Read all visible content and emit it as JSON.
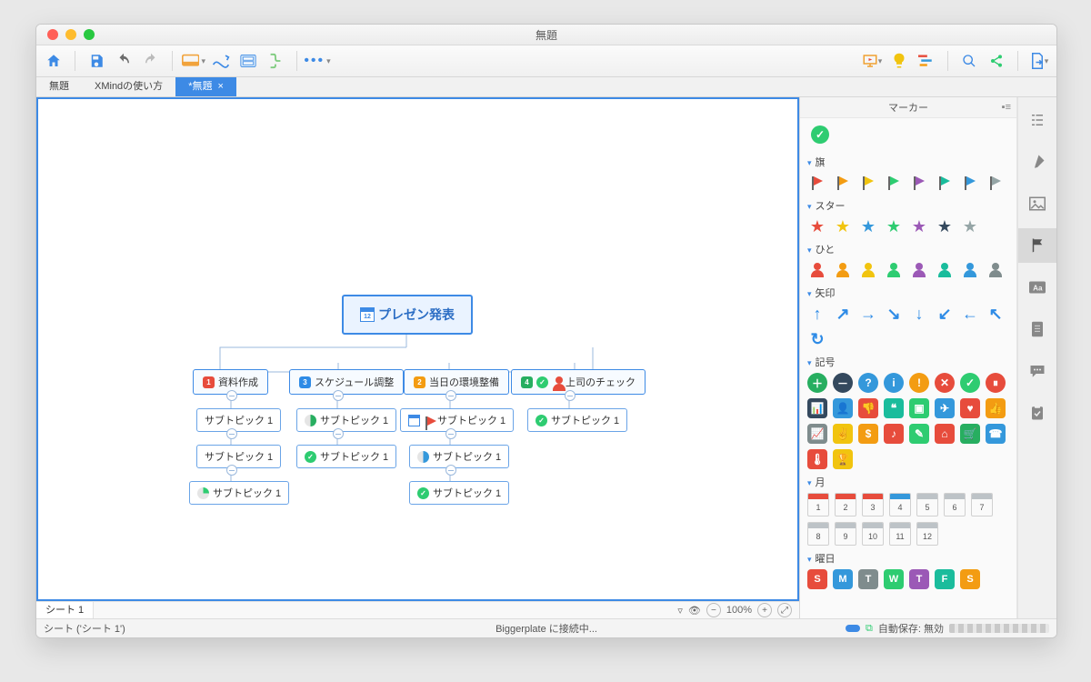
{
  "window": {
    "title": "無題"
  },
  "toolbar": {
    "items": [
      "home",
      "save",
      "undo",
      "redo",
      "style",
      "layout",
      "export",
      "outline",
      "more"
    ],
    "right_items": [
      "presentation",
      "idea",
      "gantt",
      "search",
      "share",
      "send"
    ]
  },
  "tabs": [
    {
      "label": "無題",
      "active": false
    },
    {
      "label": "XMindの使い方",
      "active": false
    },
    {
      "label": "*無題",
      "active": true,
      "closable": true
    }
  ],
  "mindmap": {
    "root": {
      "label": "プレゼン発表"
    },
    "branches": [
      {
        "badge": {
          "num": "1",
          "color": "#e74c3c"
        },
        "label": "資料作成",
        "subs": [
          {
            "label": "サブトピック 1"
          },
          {
            "label": "サブトピック 1"
          },
          {
            "label": "サブトピック 1",
            "icon": "pie-quarter"
          }
        ]
      },
      {
        "badge": {
          "num": "3",
          "color": "#2e8be6"
        },
        "label": "スケジュール調整",
        "subs": [
          {
            "label": "サブトピック 1",
            "icon": "pie-half"
          },
          {
            "label": "サブトピック 1",
            "icon": "check-green"
          }
        ]
      },
      {
        "badge": {
          "num": "2",
          "color": "#f39c12"
        },
        "label": "当日の環境整備",
        "subs": [
          {
            "label": "サブトピック 1",
            "icons": [
              "cal",
              "flag-red"
            ]
          },
          {
            "label": "サブトピック 1",
            "icon": "pie-half-blue"
          },
          {
            "label": "サブトピック 1",
            "icon": "check-green"
          }
        ]
      },
      {
        "badge": {
          "num": "4",
          "color": "#27ae60"
        },
        "extra_icons": [
          "check-green",
          "user-red"
        ],
        "label": "上司のチェック",
        "subs": [
          {
            "label": "サブトピック 1",
            "icon": "check-green"
          }
        ]
      }
    ]
  },
  "sheet": {
    "tab": "シート 1",
    "zoom": "100%"
  },
  "marker_panel": {
    "title": "マーカー",
    "sections": {
      "flag": {
        "title": "旗",
        "colors": [
          "#e74c3c",
          "#f39c12",
          "#f1c40f",
          "#2ecc71",
          "#9b59b6",
          "#1abc9c",
          "#3498db",
          "#95a5a6"
        ]
      },
      "star": {
        "title": "スター",
        "colors": [
          "#e74c3c",
          "#f1c40f",
          "#3498db",
          "#2ecc71",
          "#9b59b6",
          "#34495e",
          "#95a5a6"
        ]
      },
      "people": {
        "title": "ひと",
        "colors": [
          "#e74c3c",
          "#f39c12",
          "#f1c40f",
          "#2ecc71",
          "#9b59b6",
          "#1abc9c",
          "#3498db",
          "#7f8c8d"
        ]
      },
      "arrow": {
        "title": "矢印",
        "glyphs": [
          "↑",
          "↗",
          "→",
          "↘",
          "↓",
          "↙",
          "←",
          "↖",
          "↻"
        ],
        "color": "#2e8be6"
      },
      "symbol": {
        "title": "記号",
        "items": [
          {
            "bg": "#27ae60",
            "t": "＋",
            "r": 1
          },
          {
            "bg": "#34495e",
            "t": "－",
            "r": 1
          },
          {
            "bg": "#3498db",
            "t": "?",
            "r": 1
          },
          {
            "bg": "#3498db",
            "t": "i",
            "r": 1
          },
          {
            "bg": "#f39c12",
            "t": "!",
            "r": 1
          },
          {
            "bg": "#e74c3c",
            "t": "✕",
            "r": 1
          },
          {
            "bg": "#2ecc71",
            "t": "✓",
            "r": 1
          },
          {
            "bg": "#e74c3c",
            "t": "⏸",
            "r": 1
          },
          {
            "bg": "#34495e",
            "t": "📊"
          },
          {
            "bg": "#3498db",
            "t": "👤"
          },
          {
            "bg": "#e74c3c",
            "t": "👎"
          },
          {
            "bg": "#1abc9c",
            "t": "❝"
          },
          {
            "bg": "#2ecc71",
            "t": "▣"
          },
          {
            "bg": "#3498db",
            "t": "✈"
          },
          {
            "bg": "#e74c3c",
            "t": "♥"
          },
          {
            "bg": "#f39c12",
            "t": "👍"
          },
          {
            "bg": "#7f8c8d",
            "t": "📈"
          },
          {
            "bg": "#f1c40f",
            "t": "✌"
          },
          {
            "bg": "#f39c12",
            "t": "$"
          },
          {
            "bg": "#e74c3c",
            "t": "♪"
          },
          {
            "bg": "#2ecc71",
            "t": "✎"
          },
          {
            "bg": "#e74c3c",
            "t": "⌂"
          },
          {
            "bg": "#27ae60",
            "t": "🛒"
          },
          {
            "bg": "#3498db",
            "t": "☎"
          },
          {
            "bg": "#e74c3c",
            "t": "🌡"
          },
          {
            "bg": "#f1c40f",
            "t": "🏆"
          }
        ]
      },
      "month": {
        "title": "月",
        "bars": [
          "#e74c3c",
          "#e74c3c",
          "#e74c3c",
          "#3498db",
          "#bdc3c7",
          "#bdc3c7",
          "#bdc3c7",
          "#bdc3c7",
          "#bdc3c7",
          "#bdc3c7",
          "#bdc3c7",
          "#bdc3c7"
        ],
        "nums": [
          "1",
          "2",
          "3",
          "4",
          "5",
          "6",
          "7",
          "8",
          "9",
          "10",
          "11",
          "12"
        ]
      },
      "weekday": {
        "title": "曜日",
        "items": [
          {
            "t": "S",
            "c": "#e74c3c"
          },
          {
            "t": "M",
            "c": "#3498db"
          },
          {
            "t": "T",
            "c": "#7f8c8d"
          },
          {
            "t": "W",
            "c": "#2ecc71"
          },
          {
            "t": "T",
            "c": "#9b59b6"
          },
          {
            "t": "F",
            "c": "#1abc9c"
          },
          {
            "t": "S",
            "c": "#f39c12"
          }
        ]
      }
    }
  },
  "right_tabs": [
    "outline",
    "format",
    "image",
    "marker",
    "text",
    "doc",
    "comment",
    "task"
  ],
  "active_right_tab": "marker",
  "statusbar": {
    "left": "シート ('シート 1')",
    "center": "Biggerplate に接続中...",
    "autosave": "自動保存: 無効"
  }
}
